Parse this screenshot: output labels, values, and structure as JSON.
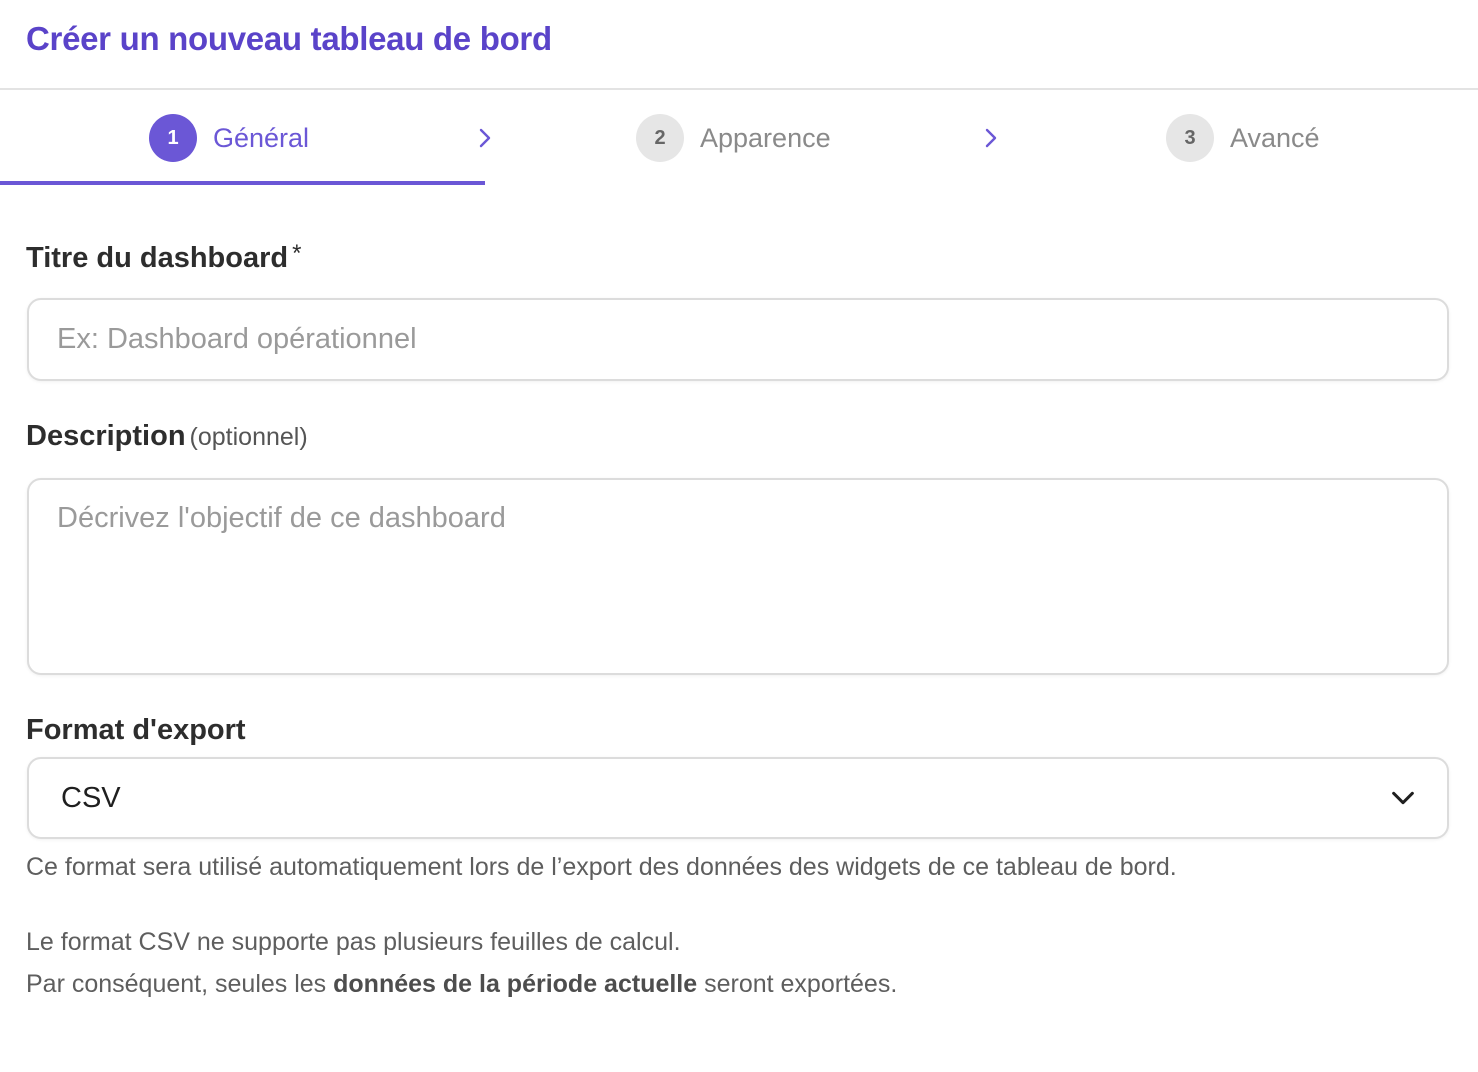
{
  "header": {
    "title": "Créer un nouveau tableau de bord"
  },
  "stepper": {
    "steps": [
      {
        "number": "1",
        "label": "Général",
        "state": "active"
      },
      {
        "number": "2",
        "label": "Apparence",
        "state": "inactive"
      },
      {
        "number": "3",
        "label": "Avancé",
        "state": "inactive"
      }
    ]
  },
  "form": {
    "title_field": {
      "label": "Titre du dashboard",
      "required_mark": "*",
      "value": "",
      "placeholder": "Ex: Dashboard opérationnel"
    },
    "description_field": {
      "label": "Description",
      "optional_text": "(optionnel)",
      "value": "",
      "placeholder": "Décrivez l'objectif de ce dashboard"
    },
    "export_format": {
      "label": "Format d'export",
      "selected": "CSV",
      "help": "Ce format sera utilisé automatiquement lors de l’export des données des widgets de ce tableau de bord.",
      "note_line1": "Le format CSV ne supporte pas plusieurs feuilles de calcul.",
      "note_line2_prefix": "Par conséquent, seules les ",
      "note_line2_bold": "données de la période actuelle",
      "note_line2_suffix": " seront exportées."
    }
  },
  "colors": {
    "accent": "#6b57d6",
    "title": "#5a43c9",
    "inactive_circle": "#e6e6e6"
  }
}
